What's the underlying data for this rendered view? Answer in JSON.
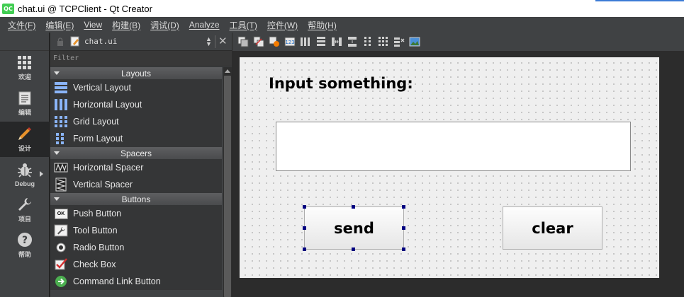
{
  "window": {
    "title": "chat.ui @ TCPClient - Qt Creator",
    "logo": "QC"
  },
  "menu": [
    "文件(F)",
    "编辑(E)",
    "View",
    "构建(B)",
    "调试(D)",
    "Analyze",
    "工具(T)",
    "控件(W)",
    "帮助(H)"
  ],
  "modes": [
    {
      "label": "欢迎",
      "icon": "grid-icon"
    },
    {
      "label": "编辑",
      "icon": "document-icon"
    },
    {
      "label": "设计",
      "icon": "pencil-icon"
    },
    {
      "label": "Debug",
      "icon": "bug-icon"
    },
    {
      "label": "项目",
      "icon": "wrench-icon"
    },
    {
      "label": "帮助",
      "icon": "help-icon"
    }
  ],
  "widgetbox": {
    "file": "chat.ui",
    "filter_placeholder": "Filter",
    "categories": {
      "layouts": "Layouts",
      "spacers": "Spacers",
      "buttons": "Buttons"
    },
    "items": {
      "vertical_layout": "Vertical Layout",
      "horizontal_layout": "Horizontal Layout",
      "grid_layout": "Grid Layout",
      "form_layout": "Form Layout",
      "horizontal_spacer": "Horizontal Spacer",
      "vertical_spacer": "Vertical Spacer",
      "push_button": "Push Button",
      "tool_button": "Tool Button",
      "radio_button": "Radio Button",
      "check_box": "Check Box",
      "command_link_button": "Command Link Button"
    },
    "push_button_icon_text": "OK"
  },
  "form": {
    "label": "Input something:",
    "input_value": "",
    "send_label": "send",
    "clear_label": "clear"
  },
  "colors": {
    "accent": "#41cd52",
    "selection_handle": "#000080",
    "panel": "#404244"
  }
}
